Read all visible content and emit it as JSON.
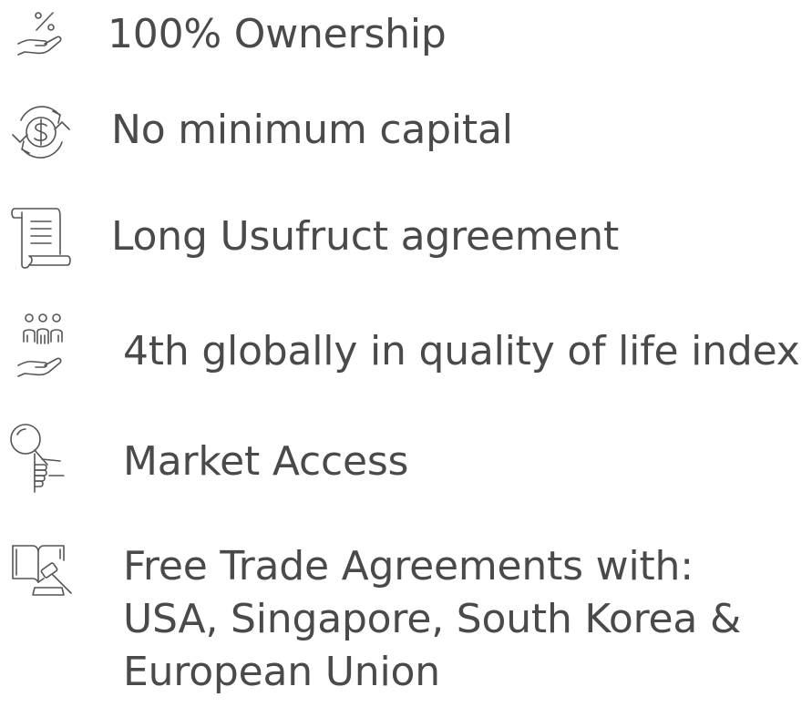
{
  "colors": {
    "text": "#4a4a4a",
    "icon_stroke": "#555555"
  },
  "benefits": [
    {
      "icon": "percent-hand-icon",
      "label": "100% Ownership"
    },
    {
      "icon": "dollar-cycle-icon",
      "label": "No minimum capital"
    },
    {
      "icon": "scroll-document-icon",
      "label": "Long Usufruct agreement"
    },
    {
      "icon": "people-hand-icon",
      "label": "4th globally in quality of life index"
    },
    {
      "icon": "magnifier-hand-icon",
      "label": "Market Access"
    },
    {
      "icon": "law-book-gavel-icon",
      "lines": [
        "Free Trade Agreements with:",
        "USA, Singapore, South Korea &",
        "European Union"
      ]
    }
  ]
}
